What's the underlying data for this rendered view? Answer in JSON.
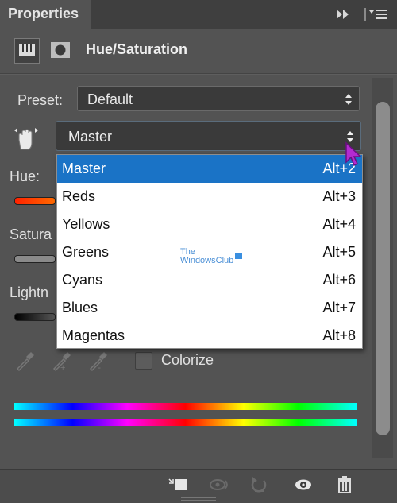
{
  "panel": {
    "tab_title": "Properties",
    "adjustment_title": "Hue/Saturation"
  },
  "preset": {
    "label": "Preset:",
    "value": "Default"
  },
  "channel": {
    "value": "Master",
    "options": [
      {
        "name": "Master",
        "shortcut": "Alt+2",
        "selected": true
      },
      {
        "name": "Reds",
        "shortcut": "Alt+3"
      },
      {
        "name": "Yellows",
        "shortcut": "Alt+4"
      },
      {
        "name": "Greens",
        "shortcut": "Alt+5"
      },
      {
        "name": "Cyans",
        "shortcut": "Alt+6"
      },
      {
        "name": "Blues",
        "shortcut": "Alt+7"
      },
      {
        "name": "Magentas",
        "shortcut": "Alt+8"
      }
    ]
  },
  "sliders": {
    "hue_label": "Hue:",
    "saturation_label": "Satura",
    "lightness_label": "Lightn"
  },
  "colorize": {
    "label": "Colorize",
    "checked": false
  },
  "watermark": {
    "line1": "The",
    "line2": "WindowsClub"
  },
  "icons": {
    "collapse": "double-chevron-right-icon",
    "menu": "panel-menu-icon",
    "adjustment": "adjustment-layer-icon",
    "mask": "layer-mask-icon",
    "hand": "targeted-adjustment-hand-icon",
    "eyedroppers": [
      "eyedropper-icon",
      "eyedropper-plus-icon",
      "eyedropper-minus-icon"
    ],
    "bottom": [
      "clip-to-layer-icon",
      "view-previous-state-icon",
      "reset-icon",
      "visibility-eye-icon",
      "trash-icon"
    ]
  },
  "colors": {
    "panel_bg": "#535353",
    "selection_blue": "#1a73c6",
    "spectrum": [
      "#00ffff",
      "#0000ff",
      "#ff00ff",
      "#ff0000",
      "#ffff00",
      "#00ff00",
      "#00ffff"
    ]
  }
}
